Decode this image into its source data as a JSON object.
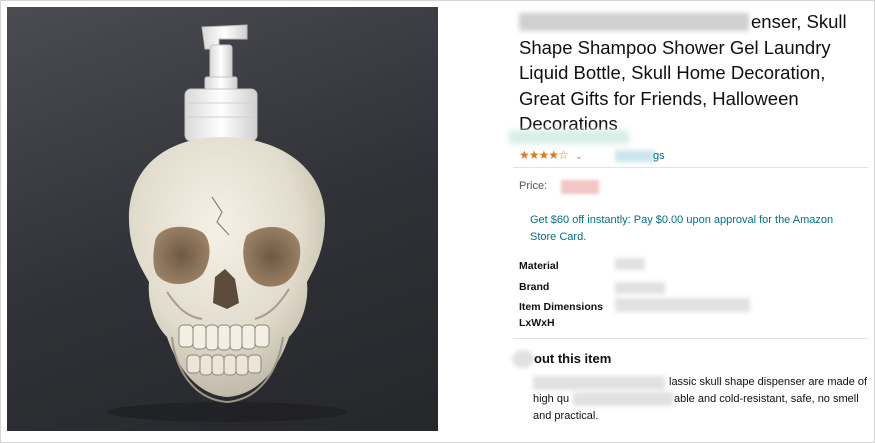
{
  "product": {
    "title_lines": [
      "enser, Skull",
      "Shape Shampoo Shower Gel Laundry",
      "Liquid Bottle, Skull Home Decoration,",
      "Great Gifts for Friends, Halloween",
      "Decorations"
    ],
    "rating_stars": "★★★★☆",
    "rating_value": 3.5,
    "rating_chevron": "⌄",
    "ratings_link": "gs",
    "price_label": "Price:",
    "promo_text_1": "Get $60 off instantly: Pay $0.00 upon approval for the Amazon",
    "promo_text_2": "Store Card.",
    "specs": [
      {
        "label": "Material"
      },
      {
        "label": "Brand"
      },
      {
        "label": "Item Dimensions"
      },
      {
        "label": "LxWxH"
      }
    ],
    "about_title": "out this item",
    "about_lines": [
      "lassic skull shape dispenser are made of",
      "high qu",
      "able and cold-resistant, safe, no smell",
      "and practical."
    ]
  },
  "image": {
    "icon": "skull-soap-dispenser-image",
    "background": "#2f3136",
    "skull_color": "#e8e3d6"
  }
}
